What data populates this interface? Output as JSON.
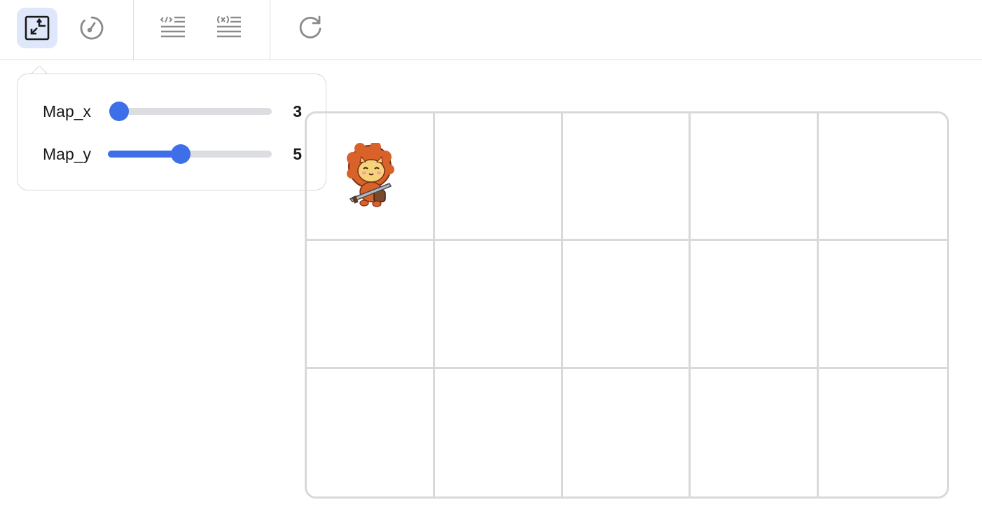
{
  "toolbar": {
    "buttons": [
      {
        "name": "map-settings-icon",
        "active": true
      },
      {
        "name": "speed-gauge-icon",
        "active": false
      },
      {
        "name": "code-view-icon",
        "active": false
      },
      {
        "name": "variables-view-icon",
        "active": false
      },
      {
        "name": "reset-icon",
        "active": false
      }
    ]
  },
  "map_settings": {
    "map_x": {
      "label": "Map_x",
      "value": "3",
      "min": 3,
      "max": 10,
      "current": 3
    },
    "map_y": {
      "label": "Map_y",
      "value": "5",
      "min": 1,
      "max": 10,
      "current": 5
    }
  },
  "grid": {
    "columns": 5,
    "rows": 3,
    "character": {
      "name": "lion-cat-warrior",
      "column": 0,
      "row": 0
    }
  },
  "colors": {
    "accent": "#3f6fe8",
    "active_bg": "#dfe8fb",
    "grid_line": "#d9d9d9",
    "track": "#dcdde1"
  }
}
